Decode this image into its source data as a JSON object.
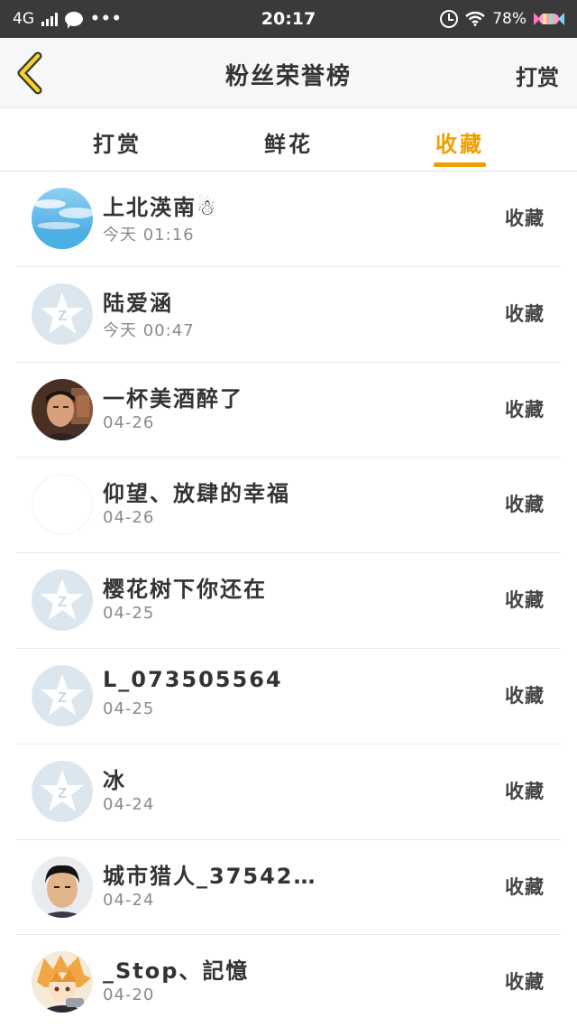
{
  "status_bar": {
    "network": "4G",
    "more": "•••",
    "time": "20:17",
    "battery": "78%"
  },
  "nav": {
    "title": "粉丝荣誉榜",
    "action": "打赏"
  },
  "tabs": [
    {
      "label": "打赏",
      "active": false
    },
    {
      "label": "鲜花",
      "active": false
    },
    {
      "label": "收藏",
      "active": true
    }
  ],
  "accent_color": "#f0a000",
  "fans": [
    {
      "name": "上北渶南☃",
      "time": "今天 01:16",
      "action": "收藏",
      "avatar": "sky-photo"
    },
    {
      "name": "陆爱涵",
      "time": "今天 00:47",
      "action": "收藏",
      "avatar": "default-qq-star"
    },
    {
      "name": "一杯美酒醉了",
      "time": "04-26",
      "action": "收藏",
      "avatar": "man-photo"
    },
    {
      "name": "仰望、放肆的幸福",
      "time": "04-26",
      "action": "收藏",
      "avatar": "blank"
    },
    {
      "name": "樱花树下你还在",
      "time": "04-25",
      "action": "收藏",
      "avatar": "default-qq-star"
    },
    {
      "name": "L_073505564",
      "time": "04-25",
      "action": "收藏",
      "avatar": "default-qq-star"
    },
    {
      "name": "冰",
      "time": "04-24",
      "action": "收藏",
      "avatar": "default-qq-star"
    },
    {
      "name": "城市猎人_37542…",
      "time": "04-24",
      "action": "收藏",
      "avatar": "boy-photo"
    },
    {
      "name": "_Stop、記憶",
      "time": "04-20",
      "action": "收藏",
      "avatar": "anime-photo"
    }
  ]
}
